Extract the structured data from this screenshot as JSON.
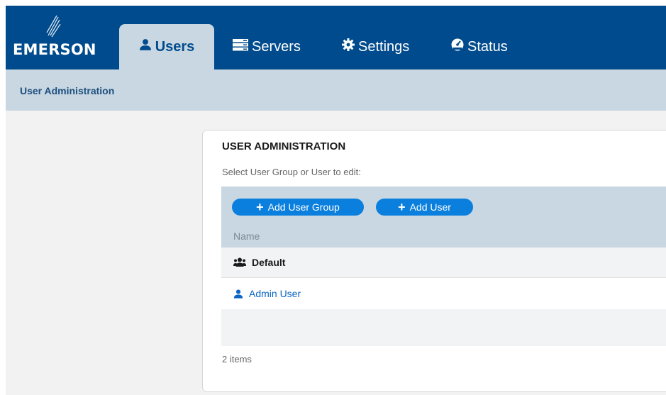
{
  "nav": {
    "logo_text": "EMERSON",
    "tabs": [
      {
        "label": "Users",
        "icon": "user-icon",
        "active": true
      },
      {
        "label": "Servers",
        "icon": "server-icon",
        "active": false
      },
      {
        "label": "Settings",
        "icon": "gear-icon",
        "active": false
      },
      {
        "label": "Status",
        "icon": "gauge-icon",
        "active": false
      }
    ]
  },
  "breadcrumb": "User Administration",
  "card": {
    "title": "USER ADMINISTRATION",
    "subtitle": "Select User Group or User to edit:",
    "add_group_label": "Add User Group",
    "add_user_label": "Add User",
    "column_name": "Name",
    "rows": [
      {
        "label": "Default",
        "icon": "user-group-icon"
      },
      {
        "label": "Admin User",
        "icon": "user-icon"
      }
    ],
    "footer": "2 items"
  },
  "colors": {
    "nav_bg": "#004b8d",
    "subbar_bg": "#c8d7e1",
    "accent": "#0a7fde",
    "link": "#0a66c2"
  }
}
